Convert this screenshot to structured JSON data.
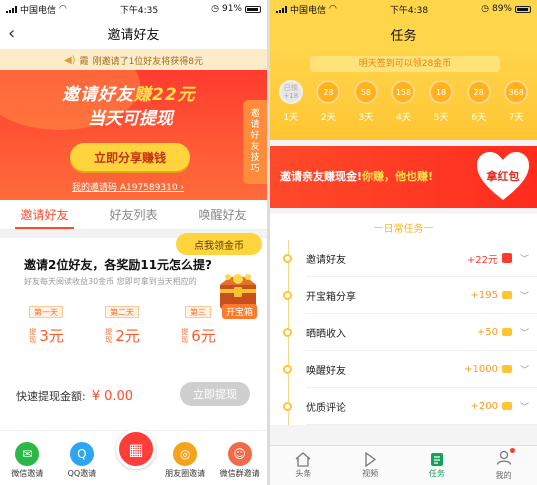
{
  "left": {
    "status": {
      "carrier": "中国电信",
      "time": "下午4:35",
      "battery": "91%",
      "battery_level": 0.91
    },
    "nav": {
      "title": "邀请好友"
    },
    "notice": {
      "user": "霞",
      "text": "刚邀请了1位好友将获得8元"
    },
    "hero": {
      "title_prefix": "邀请好友",
      "title_amount": "赚22元",
      "subtitle": "当天可提现",
      "share_button": "立即分享赚钱",
      "invite_code": "我的邀请码 A197589310",
      "tips": "邀请好友技巧"
    },
    "tabs": [
      {
        "label": "邀请好友",
        "active": true
      },
      {
        "label": "好友列表",
        "active": false
      },
      {
        "label": "唤醒好友",
        "active": false
      }
    ],
    "question": {
      "title": "邀请2位好友，各奖励11元怎么提?",
      "desc": "好友每天阅读收益30金币 您即可拿到当天相应的"
    },
    "coin_bubble": "点我领金币",
    "chest_label": "开宝箱",
    "steps": [
      {
        "day": "第一天",
        "label": "提现",
        "amount": "3元"
      },
      {
        "day": "第二天",
        "label": "提现",
        "amount": "2元"
      },
      {
        "day": "第三",
        "label": "提现",
        "amount": "6元"
      }
    ],
    "fast_withdraw": {
      "label": "快速提现金额:",
      "amount": "¥ 0.00",
      "button": "立即提现"
    },
    "share_bar": [
      {
        "label": "微信邀请",
        "color": "#2bb845",
        "icon": "wechat-icon",
        "glyph": "✉"
      },
      {
        "label": "QQ邀请",
        "color": "#2da6f0",
        "icon": "qq-icon",
        "glyph": "Q"
      },
      {
        "label": "朋友圈邀请",
        "color": "#f4a31a",
        "icon": "moments-icon",
        "glyph": "◎"
      },
      {
        "label": "微信群邀请",
        "color": "#f06b4a",
        "icon": "group-icon",
        "glyph": "☺"
      }
    ]
  },
  "right": {
    "status": {
      "carrier": "中国电信",
      "time": "下午4:38",
      "battery": "89%",
      "battery_level": 0.89
    },
    "nav": {
      "title": "任务"
    },
    "sign": {
      "banner": "明天签到可以领28金币",
      "days": [
        {
          "coin": "已领+18",
          "label": "1天",
          "done": true
        },
        {
          "coin": "28",
          "label": "2天"
        },
        {
          "coin": "58",
          "label": "3天"
        },
        {
          "coin": "158",
          "label": "4天"
        },
        {
          "coin": "18",
          "label": "5天"
        },
        {
          "coin": "28",
          "label": "6天"
        },
        {
          "coin": "368",
          "label": "7天"
        }
      ]
    },
    "banner": {
      "text_a": "邀请亲友赚现金!",
      "text_b": "你赚，他也赚!",
      "heart": "拿红包"
    },
    "section_title": "日常任务",
    "tasks": [
      {
        "name": "邀请好友",
        "reward": "+22元",
        "red": true
      },
      {
        "name": "开宝箱分享",
        "reward": "+195"
      },
      {
        "name": "晒晒收入",
        "reward": "+50"
      },
      {
        "name": "唤醒好友",
        "reward": "+1000"
      },
      {
        "name": "优质评论",
        "reward": "+200"
      }
    ],
    "bottom_nav": [
      {
        "label": "头条",
        "icon": "home-icon"
      },
      {
        "label": "视频",
        "icon": "play-icon"
      },
      {
        "label": "任务",
        "icon": "task-icon",
        "active": true
      },
      {
        "label": "我的",
        "icon": "profile-icon",
        "badge": true
      }
    ]
  }
}
